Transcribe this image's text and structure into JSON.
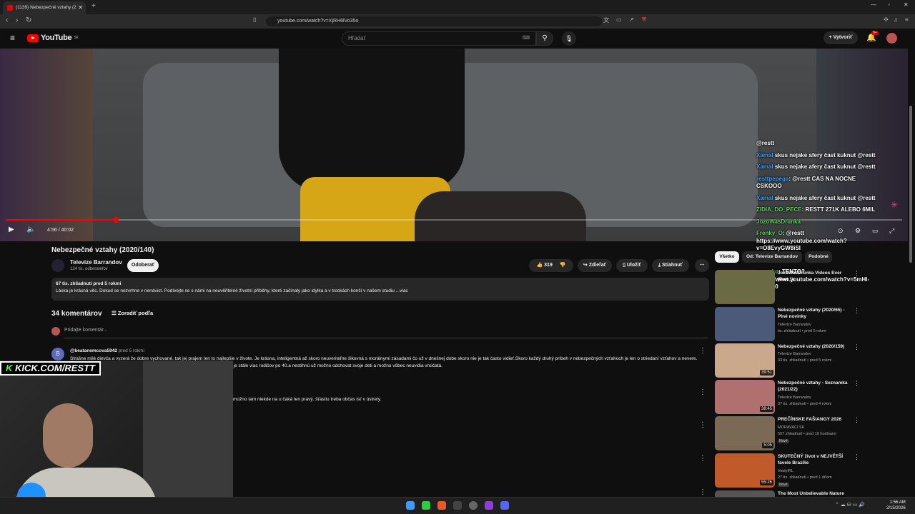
{
  "browser": {
    "tab_title": "(1139) Nebezpečné vztahy (2",
    "url": "youtube.com/watch?v=XjRH6lVo35o"
  },
  "youtube": {
    "logo": "YouTube",
    "logo_region": "SK",
    "search_placeholder": "Hľadať",
    "create_label": "Vytvoriť",
    "notification_count": "9+"
  },
  "player": {
    "time": "4:56 / 40:02",
    "progress_fraction": 0.123
  },
  "chat": [
    {
      "user": "",
      "text": "@restt"
    },
    {
      "user": "Xamal",
      "text": "skus nejake afery čast kuknut @restt"
    },
    {
      "user": "Xamal",
      "text": "skus nejake afery čast kuknut @restt"
    },
    {
      "user": "resttpepega",
      "text": "@restt CAS NA NOCNE CSKOOO"
    },
    {
      "user": "Xamal",
      "text": "skus nejake afery čast kuknut @restt"
    },
    {
      "user": "ZIDIA_DO_PECE",
      "text": "RESTT 271K ALEBO 6MIL"
    },
    {
      "user": "JozoWasDrunka",
      "text": ""
    },
    {
      "user": "Frenky_O",
      "text": "@restt https://www.youtube.com/watch?v=O8EvyGW8iSI"
    },
    {
      "user": "",
      "text": "nooo"
    },
    {
      "user": "negarko",
      "text": "TENTO? https://www.youtube.com/watch?v=5mHI-VgRyN0"
    }
  ],
  "video": {
    "title": "Nebezpečné vztahy (2020/140)",
    "channel": "Televize Barrandov",
    "subscribers": "124 tis. odberateľov",
    "subscribe_label": "Odoberať",
    "likes": "319",
    "share_label": "Zdieľať",
    "save_label": "Uložiť",
    "download_label": "Stiahnuť",
    "views_date": "67 tis. zhliadnutí  pred 5 rokmi",
    "description": "Láska je krásná věc. Dokud se nezvrhne v nenávist. Podívejte se s námi na neuvěřitelné životní příběhy, které začínaly jako idylka a v troskách končí v našem studiu ...viac"
  },
  "comments": {
    "count_label": "34 komentárov",
    "sort_label": "Zoradiť podľa",
    "add_placeholder": "Pridajte komentár...",
    "items": [
      {
        "avatar": "B",
        "author": "@beatanemcova5942",
        "time": "pred 5 rokmi",
        "text": "Strašne milé dievča a vyzerá že dobre vychované. tak jej prajem len to najlepšie v živote. Je krásna, inteligentná až skoro neuveriteľne šikovná s morálnymi zásadami čo už v dnešnej dobe skoro nie je tak často vidieť.Skoro každý druhý príbeh v nebezpečných vzťahoch je len o striedaní vzťahov a nevere. Vzhľadom k tomu, že tak skoro stratila rodičov.Mozno i na zamyslenie ,že dnes je stále viac rodičov po 40.a nestihnú už možno odchovat svoje deti a možno vôbec neuvidia vnúčatá."
      },
      {
        "text": "možno tam niekde na u čaká ten pravý..šťastiu treba občas ísť v ústrety."
      }
    ]
  },
  "sidebar": {
    "chips": [
      "Všetko",
      "Od: Televize Barrandov",
      "Podobné"
    ],
    "items": [
      {
        "title": "JozoWasDrunka Videos Ever (Part 1)",
        "channel": "",
        "meta": "",
        "duration": "",
        "color": "#6a6a45"
      },
      {
        "title": "Nebezpečné vztahy (2020/65) - Plné novinky",
        "channel": "Televize Barrandov",
        "meta": "tis. zhliadnutí • pred 5 rokmi",
        "duration": "",
        "color": "#4a5a78"
      },
      {
        "title": "Nebezpečné vztahy (2020/159)",
        "channel": "Televize Barrandov",
        "meta": "33 tis. zhliadnutí • pred 5 rokmi",
        "duration": "39:51",
        "color": "#c9a88c"
      },
      {
        "title": "Nebezpečné vztahy - Seznamka (2021/22)",
        "channel": "Televize Barrandov",
        "meta": "37 tis. zhliadnutí • pred 4 rokmi",
        "duration": "38:45",
        "color": "#b07070"
      },
      {
        "title": "PREČÍNSKE FAŠIANGY 2026",
        "channel": "MORAVACI SK",
        "meta": "507 zhliadnutí • pred 10 hodinami",
        "duration": "5:05",
        "new": "Nové",
        "color": "#7a6a55"
      },
      {
        "title": "SKUTEČNÝ život v NEJVĚTŠÍ favele Brazílie",
        "channel": "VoidyIRL",
        "meta": "27 tis. zhliadnutí • pred 1 dňom",
        "duration": "55:26",
        "new": "Nové",
        "color": "#c05a2a"
      },
      {
        "title": "The Most Unbelievable Nature",
        "channel": "",
        "meta": "",
        "duration": "",
        "color": "#555"
      }
    ]
  },
  "overlay": {
    "kick_prefix": "K",
    "kick_label": "KICK.COM/RESTT"
  },
  "taskbar": {
    "time": "1:56 AM",
    "date": "2/15/2026"
  }
}
